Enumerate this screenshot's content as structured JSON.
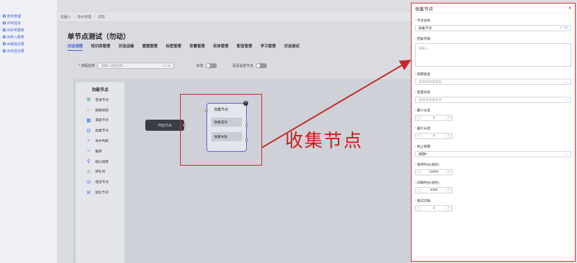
{
  "sidebar": {
    "items": [
      {
        "label": "技术管理"
      },
      {
        "label": "外呼任务"
      },
      {
        "label": "AI外呼报表"
      },
      {
        "label": "AI呼入报表"
      },
      {
        "label": "AI通话记录"
      },
      {
        "label": "AI对话记录"
      }
    ]
  },
  "breadcrumb": {
    "items": [
      "机器人",
      "技术管理",
      "详情"
    ]
  },
  "page": {
    "title": "单节点测试（勿动）"
  },
  "tabs": [
    {
      "label": "对话流程",
      "active": true
    },
    {
      "label": "知识库管理"
    },
    {
      "label": "对话话端"
    },
    {
      "label": "意图管理"
    },
    {
      "label": "标签管理"
    },
    {
      "label": "变量管理"
    },
    {
      "label": "实体管理"
    },
    {
      "label": "配音管理"
    },
    {
      "label": "学习管理"
    },
    {
      "label": "对话测试"
    }
  ],
  "filters": {
    "flow_name_label": "* 流程名称",
    "flow_name_placeholder": "请输入流程名称",
    "flow_name_count": "0 / 80",
    "status_label": "状态",
    "first_node_label": "是否是首节点"
  },
  "func_panel": {
    "title": "功能节点",
    "items": [
      {
        "label": "普通节点",
        "icon": "plus-node-icon",
        "glyph": "⊞",
        "color": "#2e9e5b"
      },
      {
        "label": "按键导航",
        "icon": "smile-icon",
        "glyph": "☺",
        "color": "#e0a020"
      },
      {
        "label": "满意节点",
        "icon": "grid-icon",
        "glyph": "▦",
        "color": "#3b6fd8"
      },
      {
        "label": "收集节点",
        "icon": "inbox-icon",
        "glyph": "⊟",
        "color": "#3b6fd8"
      },
      {
        "label": "条件判断",
        "icon": "branch-icon",
        "glyph": "⑃",
        "color": "#8a3bd8"
      },
      {
        "label": "跳转",
        "icon": "jump-icon",
        "glyph": "⤷",
        "color": "#3b6fd8"
      },
      {
        "label": "接口调用",
        "icon": "link-icon",
        "glyph": "⚲",
        "color": "#8a3bd8"
      },
      {
        "label": "转队列",
        "icon": "queue-icon",
        "glyph": "⚠",
        "color": "#2e9e5b"
      },
      {
        "label": "电话节点",
        "icon": "phone-icon",
        "glyph": "☏",
        "color": "#3b6fd8"
      },
      {
        "label": "短信节点",
        "icon": "message-icon",
        "glyph": "✉",
        "color": "#3b6fd8"
      }
    ]
  },
  "canvas": {
    "start_node": "开始节点",
    "collect_node": {
      "title": "收集节点",
      "rows": [
        "收集成功",
        "收集失败"
      ]
    }
  },
  "annotation": {
    "label": "收集节点",
    "color": "#d01818"
  },
  "panel": {
    "title": "收集节点",
    "fields": {
      "node_name": {
        "label": "节点名称",
        "value": "收集节点",
        "count": "4 / 20"
      },
      "reply": {
        "label": "回复内容",
        "placeholder": "请输入"
      },
      "key_type": {
        "label": "按键类型",
        "placeholder": "请选择按键类型"
      },
      "var_name": {
        "label": "变量名称",
        "placeholder": "请选择变量名称"
      },
      "min_len": {
        "label": "最小长度",
        "value": "1"
      },
      "max_len": {
        "label": "最大长度",
        "value": "1"
      },
      "stop_key": {
        "label": "终止按键",
        "value": "按键#"
      },
      "wait_time": {
        "label": "等待时长(毫秒)",
        "value": "10000"
      },
      "interval": {
        "label": "间隔时长(毫秒)",
        "value": "2000"
      },
      "retry": {
        "label": "重试次数",
        "value": "1"
      }
    }
  }
}
